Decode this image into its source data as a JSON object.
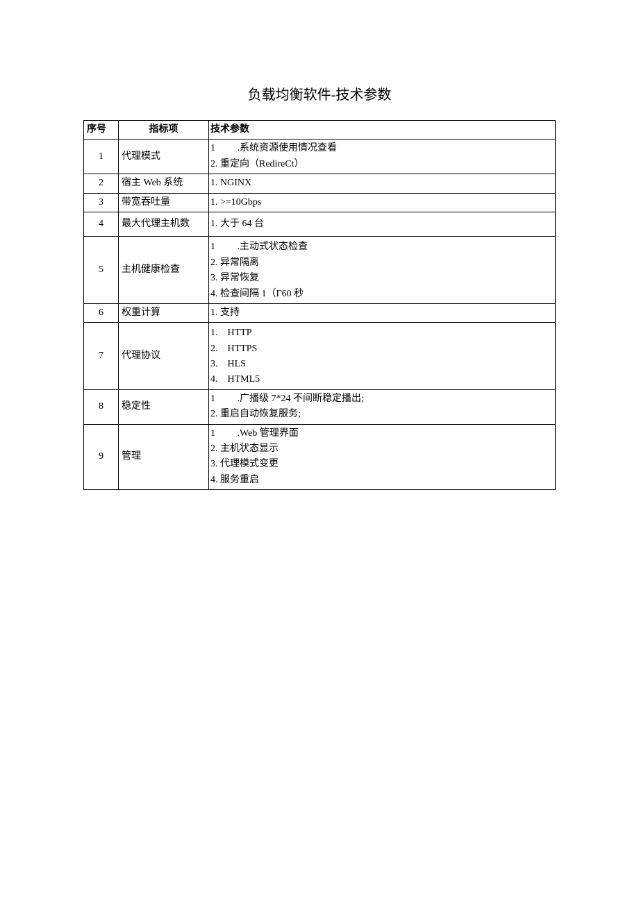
{
  "title": "负载均衡软件-技术参数",
  "headers": {
    "seq": "序号",
    "item": "指标项",
    "param": "技术参数"
  },
  "rows": [
    {
      "seq": "1",
      "item": "代理模式",
      "params": [
        "1   .系统资源使用情况查看",
        "2. 重定向（RedireCt）"
      ]
    },
    {
      "seq": "2",
      "item": "宿主 Web 系统",
      "params": [
        "1. NGINX"
      ]
    },
    {
      "seq": "3",
      "item": "带宽吞吐量",
      "params": [
        "1. >=10Gbps"
      ]
    },
    {
      "seq": "4",
      "item": "最大代理主机数",
      "params": [
        "1. 大于 64 台"
      ]
    },
    {
      "seq": "5",
      "item": "主机健康检查",
      "params": [
        "1   .主动式状态检查",
        "2. 异常隔离",
        "3. 异常恢复",
        "4. 检查间隔 1（Γ60 秒"
      ]
    },
    {
      "seq": "6",
      "item": "权重计算",
      "params": [
        "1. 支持"
      ]
    },
    {
      "seq": "7",
      "item": "代理协议",
      "params": [
        "1. HTTP",
        "2. HTTPS",
        "3. HLS",
        "4. HTML5"
      ]
    },
    {
      "seq": "8",
      "item": "稳定性",
      "params": [
        "1   .广播级 7*24 不间断稳定播出;",
        "2. 重启自动恢复服务;"
      ]
    },
    {
      "seq": "9",
      "item": "管理",
      "params": [
        "1   .Web 管理界面",
        "2. 主机状态显示",
        "3. 代理模式变更",
        "4. 服务重启"
      ]
    }
  ]
}
